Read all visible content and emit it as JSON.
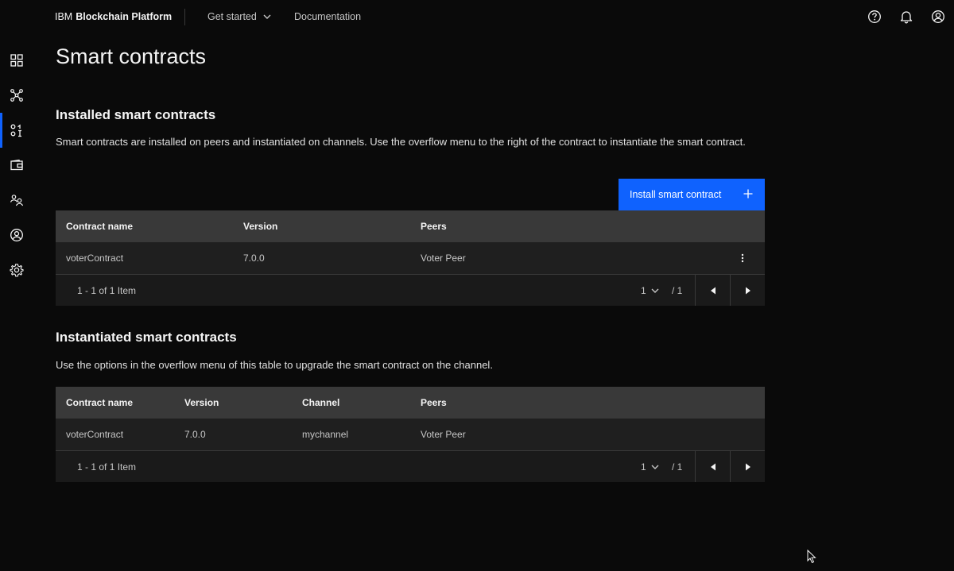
{
  "header": {
    "brand_prefix": "IBM",
    "brand_name": "Blockchain Platform",
    "nav": [
      {
        "label": "Get started"
      },
      {
        "label": "Documentation"
      }
    ],
    "icons": [
      "help-icon",
      "notification-icon",
      "user-avatar-icon"
    ]
  },
  "sidenav": {
    "items": [
      {
        "name": "dashboard-icon"
      },
      {
        "name": "network-icon"
      },
      {
        "name": "smart-contracts-icon",
        "active": true
      },
      {
        "name": "wallet-icon"
      },
      {
        "name": "organizations-icon"
      },
      {
        "name": "users-icon"
      },
      {
        "name": "settings-icon"
      }
    ]
  },
  "page": {
    "title": "Smart contracts"
  },
  "installed": {
    "title": "Installed smart contracts",
    "description": "Smart contracts are installed on peers and instantiated on channels. Use the overflow menu to the right of the contract to instantiate the smart contract.",
    "button_label": "Install smart contract",
    "headers": {
      "name": "Contract name",
      "version": "Version",
      "peers": "Peers"
    },
    "rows": [
      {
        "name": "voterContract",
        "version": "7.0.0",
        "peers": "Voter Peer"
      }
    ],
    "pagination": {
      "range": "1 - 1 of 1 Item",
      "page": "1",
      "total": "/ 1"
    }
  },
  "instantiated": {
    "title": "Instantiated smart contracts",
    "description": "Use the options in the overflow menu of this table to upgrade the smart contract on the channel.",
    "headers": {
      "name": "Contract name",
      "version": "Version",
      "channel": "Channel",
      "peers": "Peers"
    },
    "rows": [
      {
        "name": "voterContract",
        "version": "7.0.0",
        "channel": "mychannel",
        "peers": "Voter Peer"
      }
    ],
    "pagination": {
      "range": "1 - 1 of 1 Item",
      "page": "1",
      "total": "/ 1"
    }
  },
  "colors": {
    "background": "#0a0a0a",
    "primary": "#0f62fe",
    "table_header": "#393939",
    "table_row": "#1f1f1f"
  }
}
